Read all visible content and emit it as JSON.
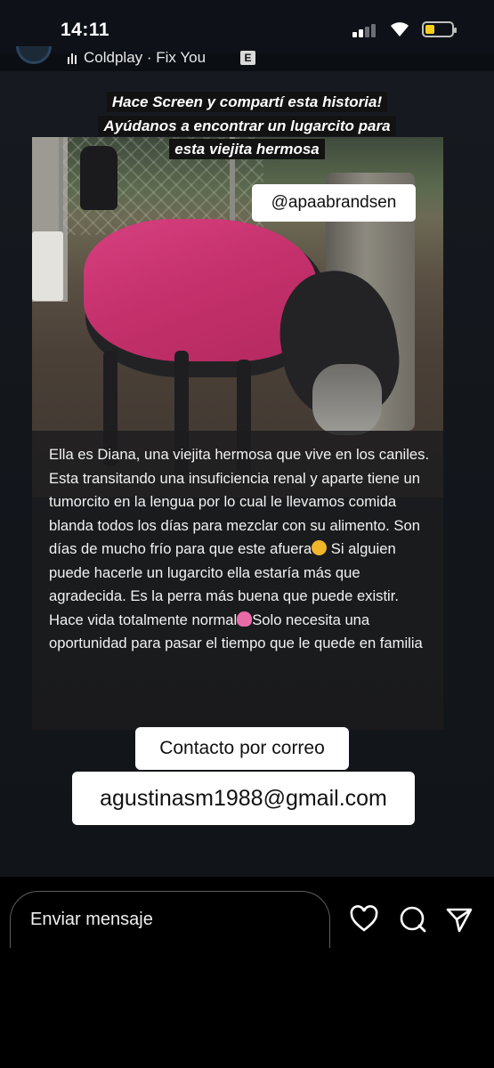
{
  "status_bar": {
    "time": "14:11",
    "battery_color": "#f5cf1b"
  },
  "story_header": {
    "song": "Coldplay · Fix You",
    "explicit_badge": "E"
  },
  "story": {
    "banner_lines": [
      "Hace Screen y compartí esta historia!",
      "Ayúdanos a encontrar un lugarcito para",
      "esta viejita hermosa"
    ],
    "handle": "@apaabrandsen",
    "body_parts": [
      "Ella es Diana, una viejita hermosa que vive en los caniles. Esta transitando una insuficiencia renal y aparte tiene un tumorcito en la lengua por lo cual le llevamos comida blanda todos los días para mezclar con su alimento. Son días de mucho frío para que este afuera",
      " Si alguien puede hacerle un lugarcito ella estaría más que agradecida. Es la perra más buena que puede existir. Hace vida totalmente normal",
      "Solo necesita una oportunidad para pasar el tiempo que le quede en familia"
    ],
    "contact_label": "Contacto por correo",
    "email": "agustinasm1988@gmail.com"
  },
  "message_bar": {
    "placeholder": "Enviar mensaje",
    "icons": [
      "heart-icon",
      "search-bubble-icon",
      "send-icon"
    ]
  }
}
